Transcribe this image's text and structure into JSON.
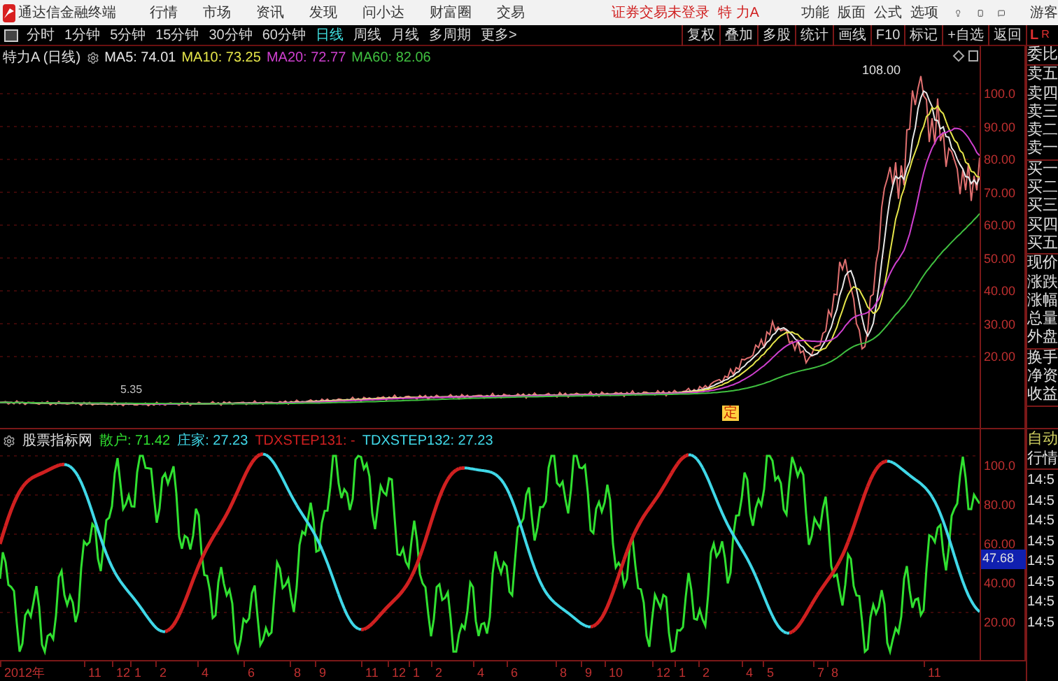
{
  "app_bar": {
    "app_name": "通达信金融终端",
    "menus": [
      "行情",
      "市场",
      "资讯",
      "发现",
      "问小达",
      "财富圈",
      "交易"
    ],
    "login_status": "证券交易未登录",
    "stock_name": "特 力A",
    "tools": [
      "功能",
      "版面",
      "公式",
      "选项"
    ],
    "user": "游客"
  },
  "period_bar": {
    "periods": [
      {
        "label": "分时",
        "selected": false
      },
      {
        "label": "1分钟",
        "selected": false
      },
      {
        "label": "5分钟",
        "selected": false
      },
      {
        "label": "15分钟",
        "selected": false
      },
      {
        "label": "30分钟",
        "selected": false
      },
      {
        "label": "60分钟",
        "selected": false
      },
      {
        "label": "日线",
        "selected": true
      },
      {
        "label": "周线",
        "selected": false
      },
      {
        "label": "月线",
        "selected": false
      },
      {
        "label": "多周期",
        "selected": false
      },
      {
        "label": "更多>",
        "selected": false
      }
    ],
    "buttons": [
      "复权",
      "叠加",
      "多股",
      "统计",
      "画线",
      "F10",
      "标记",
      "+自选",
      "返回"
    ],
    "corner_labels": [
      "L",
      "R"
    ]
  },
  "main_chart": {
    "title": "特力A (日线)",
    "ma": [
      {
        "label": "MA5: 74.01",
        "color": "#e8e8e8"
      },
      {
        "label": "MA10: 73.25",
        "color": "#e6e64a"
      },
      {
        "label": "MA20: 72.77",
        "color": "#d040d0"
      },
      {
        "label": "MA60: 82.06",
        "color": "#40c040"
      }
    ],
    "high_label": "108.00",
    "low_label": "5.35",
    "marker": "定",
    "yaxis": [
      "100.0",
      "90.00",
      "80.00",
      "70.00",
      "60.00",
      "50.00",
      "40.00",
      "30.00",
      "20.00"
    ]
  },
  "indicator": {
    "name": "股票指标网",
    "lines": [
      {
        "label": "散户: 71.42",
        "color": "#30e030"
      },
      {
        "label": "庄家: 27.23",
        "color": "#40d8e8"
      },
      {
        "label": "TDXSTEP131: -",
        "color": "#d02020"
      },
      {
        "label": "TDXSTEP132: 27.23",
        "color": "#40d8e8"
      }
    ],
    "yaxis": [
      "100.0",
      "80.00",
      "60.00",
      "40.00",
      "20.00"
    ],
    "current_value": "47.68"
  },
  "xaxis": [
    "2012年",
    "11",
    "12",
    "1",
    "2",
    "4",
    "6",
    "8",
    "9",
    "11",
    "12",
    "1",
    "2",
    "4",
    "6",
    "8",
    "9",
    "10",
    "12",
    "1",
    "2",
    "4",
    "5",
    "7",
    "8",
    "11"
  ],
  "quote_panel": {
    "groups": [
      [
        "委比"
      ],
      [
        "卖五",
        "卖四",
        "卖三",
        "卖二",
        "卖一"
      ],
      [
        "买一",
        "买二",
        "买三",
        "买四",
        "买五"
      ],
      [
        "现价",
        "涨跌",
        "涨幅",
        "总量",
        "外盘"
      ],
      [
        "换手",
        "净资",
        "收益"
      ]
    ],
    "mode": "自动",
    "tab": "行情",
    "times": [
      "14:5",
      "14:5",
      "14:5",
      "14:5",
      "14:5",
      "14:5",
      "14:5",
      "14:5"
    ]
  }
}
